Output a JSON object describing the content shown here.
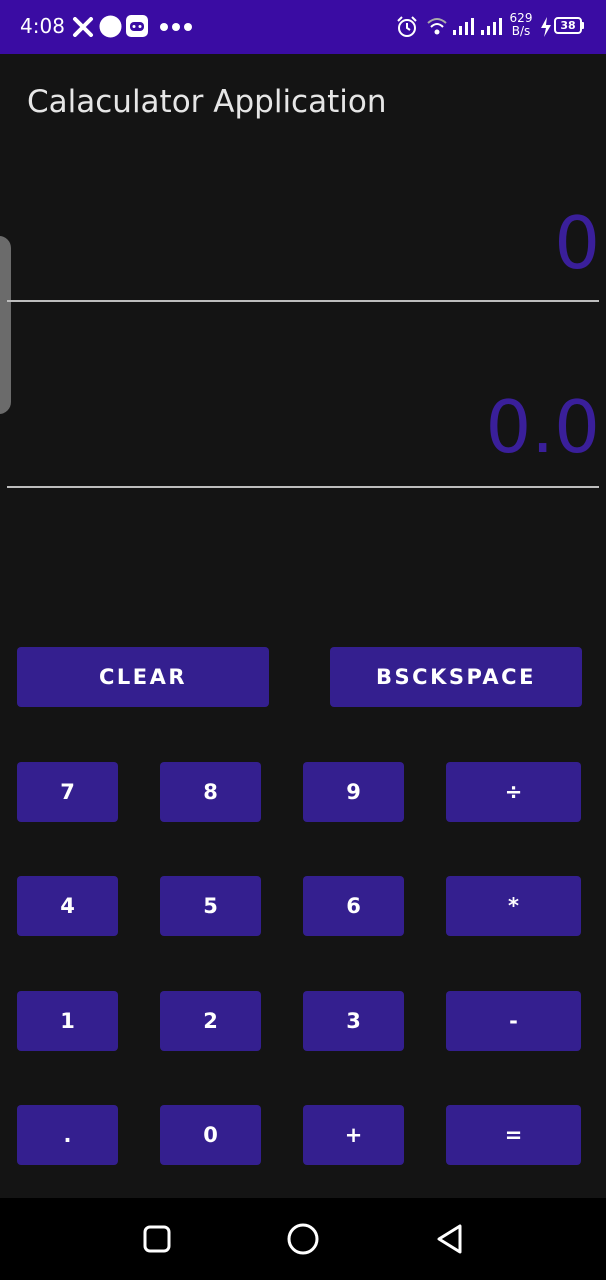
{
  "status_bar": {
    "time": "4:08",
    "net_speed_value": "629",
    "net_speed_unit": "B/s",
    "battery": "38",
    "icons": [
      "x-icon",
      "dot-icon",
      "gamepad-icon",
      "more-dots-icon",
      "alarm-icon",
      "wifi-icon",
      "signal-icon",
      "signal-icon",
      "charging-icon",
      "battery-icon"
    ]
  },
  "app": {
    "title": "Calaculator Application"
  },
  "display": {
    "input": "0",
    "result": "0.0"
  },
  "actions": {
    "clear": "CLEAR",
    "backspace": "BSCKSPACE"
  },
  "keypad": {
    "rows": [
      [
        "7",
        "8",
        "9",
        "÷"
      ],
      [
        "4",
        "5",
        "6",
        "*"
      ],
      [
        "1",
        "2",
        "3",
        "-"
      ],
      [
        ".",
        "0",
        "+",
        "="
      ]
    ]
  },
  "nav_bar": {
    "buttons": [
      "recents-icon",
      "home-icon",
      "back-icon"
    ]
  },
  "colors": {
    "status_bar": "#3a0ca3",
    "background": "#141414",
    "button": "#341f8f",
    "display_text": "#3a1f9a"
  }
}
